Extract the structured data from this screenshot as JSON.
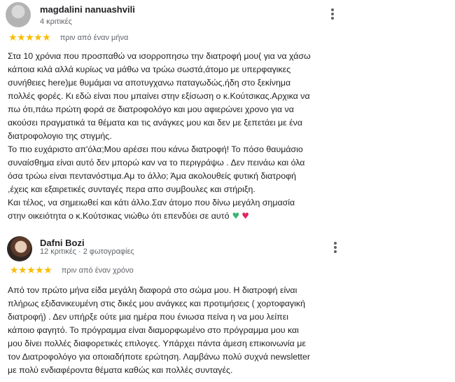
{
  "reviews": [
    {
      "author": "magdalini nanuashvili",
      "meta": "4 κριτικές",
      "stars": "★★★★★",
      "rating": 5,
      "date": "πριν από έναν μήνα",
      "lines": [
        "Στα 10 χρόνια που προσπαθώ να ισορροπησω την διατροφή μου( για να χάσω",
        "κάποια κιλά αλλά κυρίως να μάθω να τρώω σωστά,άτομο με υπερφαγικες",
        "συνήθειες here)με θυμάμαι να αποτυγχανω παταγωδώς,ήδη στο ξεκίνημα",
        "πολλές φορές. Κι εδώ είναι που μπαίνει στην εξίσωση ο κ.Κούτσικας.Αρχικα να",
        "πω ότι,πάω πρώτη φορά σε διατροφολόγο και μου αφιερώνει χρονο για να",
        "ακούσει πραγματικά τα θέματα και τις ανάγκες μου και δεν με ξεπετάει με ένα",
        "διατροφολογιο της στιγμής.",
        "Το πιο ευχάριστο απ'όλα;Μου αρέσει που κάνω διατροφή! Το πόσο θαυμάσιο",
        "συναίσθημα είναι αυτό δεν μπορώ καν να το περιγράψω . Δεν πεινάω και όλα",
        "όσα τρώω είναι πεντανόστιμα.Αμ το άλλο; Άμα ακολουθείς φυτική διατροφή",
        ",έχεις και εξαιρετικές συνταγές περα απο συμβουλες και στήριξη.",
        "Και τέλος, να σημειωθεί και κάτι άλλο.Σαν άτομο που δίνω μεγάλη σημασία",
        "στην οικειότητα ο κ.Κούτσικας νιώθω ότι επενδύει σε αυτό"
      ],
      "hearts": {
        "green": "♥",
        "red": "♥"
      }
    },
    {
      "author": "Dafni Bozi",
      "meta": "12 κριτικές · 2 φωτογραφίες",
      "stars": "★★★★★",
      "rating": 5,
      "date": "πριν από έναν χρόνο",
      "lines": [
        "Από τον πρώτο μήνα είδα μεγάλη διαφορά στο σώμα μου. Η διατροφή είναι",
        "πλήρως εξιδανικευμένη στις δικές μου ανάγκες και προτιμήσεις ( χορτοφαγική",
        "διατροφή) . Δεν υπήρξε ούτε μια ημέρα που ένιωσα πείνα η να μου λείπει",
        "κάποιο φαγητό. Το πρόγραμμα είναι διαμορφωμένο στο πρόγραμμα μου και",
        "μου δίνει πολλές διαφορετικές επιλογες. Υπάρχει πάντα άμεση επικοινωνία με",
        "τον Διατροφολόγο για οποιαδήποτε ερώτηση. Λαμβάνω πολύ συχνά newsletter",
        "με πολύ ενδιαφέροντα θέματα καθώς και πολλές συνταγές."
      ]
    }
  ],
  "colors": {
    "star": "#fbbc04",
    "secondary_text": "#5f6368",
    "text": "#202124"
  },
  "icons": {
    "menu": "more-vert-icon",
    "avatar": "avatar-photo"
  }
}
